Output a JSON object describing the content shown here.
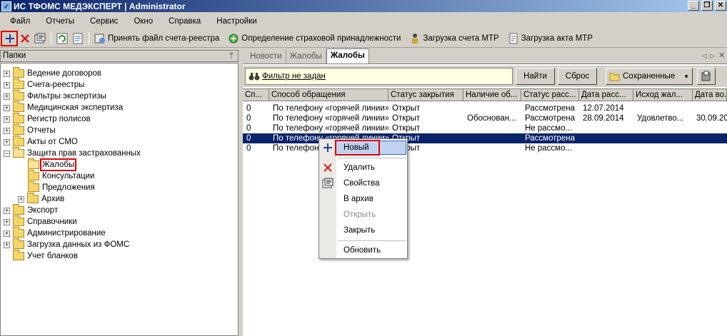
{
  "window": {
    "title": "ИС ТФОМС МЕДЭКСПЕРТ | Administrator",
    "minimize": "_",
    "restore": "❐",
    "close": "✕"
  },
  "menu": [
    "Файл",
    "Отчеты",
    "Сервис",
    "Окно",
    "Справка",
    "Настройки"
  ],
  "toolbar": {
    "accept_file": "Принять файл счета-реестра",
    "insurance": "Определение страховой принадлежности",
    "load_mtr_account": "Загрузка счета МТР",
    "load_mtr_act": "Загрузка акта МТР"
  },
  "left_panel": {
    "title": "Папки",
    "tree": [
      "Ведение договоров",
      "Счета-реестры",
      "Фильтры экспертизы",
      "Медицинская экспертиза",
      "Регистр полисов",
      "Отчеты",
      "Акты от СМО",
      "Защита прав застрахованных",
      "Жалобы",
      "Консультации",
      "Предложения",
      "Архив",
      "Экспорт",
      "Справочники",
      "Администрирование",
      "Загрузка данных из ФОМС",
      "Учет бланков"
    ]
  },
  "tabs": [
    "Новости",
    "Жалобы",
    "Жалобы"
  ],
  "filter": {
    "text": "Фильтр не задан",
    "find": "Найти",
    "reset": "Сброс",
    "saved": "Сохраненные"
  },
  "grid": {
    "columns": [
      "Сп...",
      "Способ обращения",
      "Статус закрытия",
      "Наличие об...",
      "Статус расс...",
      "Дата расс...",
      "Исход жал...",
      "Дата во..."
    ],
    "rows": [
      [
        "0",
        "По телефону «горячей линии»",
        "Открыт",
        "",
        "Рассмотрена",
        "12.07.2014",
        "",
        ""
      ],
      [
        "0",
        "По телефону «горячей линии»",
        "Открыт",
        "Обоснован...",
        "Рассмотрена",
        "28.09.2014",
        "Удовлетво...",
        "30.09.2014"
      ],
      [
        "0",
        "По телефону «горячей линии»",
        "Открыт",
        "",
        "Не рассмо...",
        "",
        "",
        ""
      ],
      [
        "0",
        "По телефону «горячей линии»",
        "Открыт",
        "",
        "Рассмотрена",
        "",
        "",
        ""
      ],
      [
        "0",
        "По телефону «горячей линии»",
        "Открыт",
        "",
        "Не рассмо...",
        "",
        "",
        ""
      ]
    ]
  },
  "context_menu": {
    "new": "Новый",
    "delete": "Удалить",
    "properties": "Свойства",
    "archive": "В архив",
    "open": "Открыть",
    "close": "Закрыть",
    "refresh": "Обновить"
  }
}
